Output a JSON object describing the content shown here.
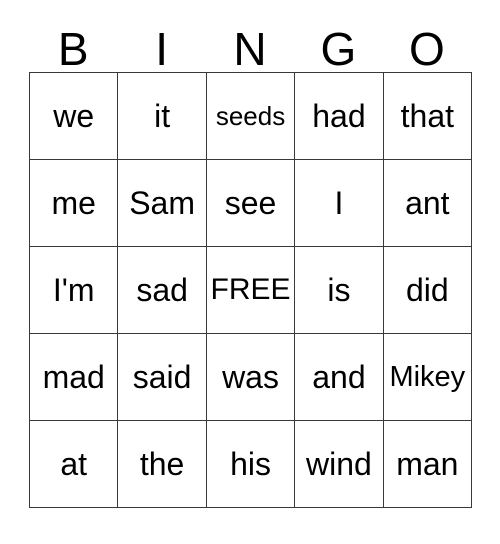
{
  "card": {
    "title": "BINGO",
    "columns": 5,
    "rows": 5,
    "free_space_label": "FREE",
    "free_space_position": {
      "row": 2,
      "col": 2
    },
    "border_color": "#3a3a3a",
    "text_color": "#000000",
    "background_color": "#ffffff",
    "header": [
      {
        "letter": "B"
      },
      {
        "letter": "I"
      },
      {
        "letter": "N"
      },
      {
        "letter": "G"
      },
      {
        "letter": "O"
      }
    ],
    "grid": [
      [
        {
          "text": "we",
          "size": "normal",
          "free": false
        },
        {
          "text": "it",
          "size": "normal",
          "free": false
        },
        {
          "text": "seeds",
          "size": "sm",
          "free": false
        },
        {
          "text": "had",
          "size": "normal",
          "free": false
        },
        {
          "text": "that",
          "size": "normal",
          "free": false
        }
      ],
      [
        {
          "text": "me",
          "size": "normal",
          "free": false
        },
        {
          "text": "Sam",
          "size": "normal",
          "free": false
        },
        {
          "text": "see",
          "size": "normal",
          "free": false
        },
        {
          "text": "I",
          "size": "normal",
          "free": false
        },
        {
          "text": "ant",
          "size": "normal",
          "free": false
        }
      ],
      [
        {
          "text": "I'm",
          "size": "normal",
          "free": false
        },
        {
          "text": "sad",
          "size": "normal",
          "free": false
        },
        {
          "text": "FREE",
          "size": "lg",
          "free": true
        },
        {
          "text": "is",
          "size": "normal",
          "free": false
        },
        {
          "text": "did",
          "size": "normal",
          "free": false
        }
      ],
      [
        {
          "text": "mad",
          "size": "normal",
          "free": false
        },
        {
          "text": "said",
          "size": "normal",
          "free": false
        },
        {
          "text": "was",
          "size": "normal",
          "free": false
        },
        {
          "text": "and",
          "size": "normal",
          "free": false
        },
        {
          "text": "Mikey",
          "size": "md",
          "free": false
        }
      ],
      [
        {
          "text": "at",
          "size": "normal",
          "free": false
        },
        {
          "text": "the",
          "size": "normal",
          "free": false
        },
        {
          "text": "his",
          "size": "normal",
          "free": false
        },
        {
          "text": "wind",
          "size": "normal",
          "free": false
        },
        {
          "text": "man",
          "size": "normal",
          "free": false
        }
      ]
    ]
  }
}
